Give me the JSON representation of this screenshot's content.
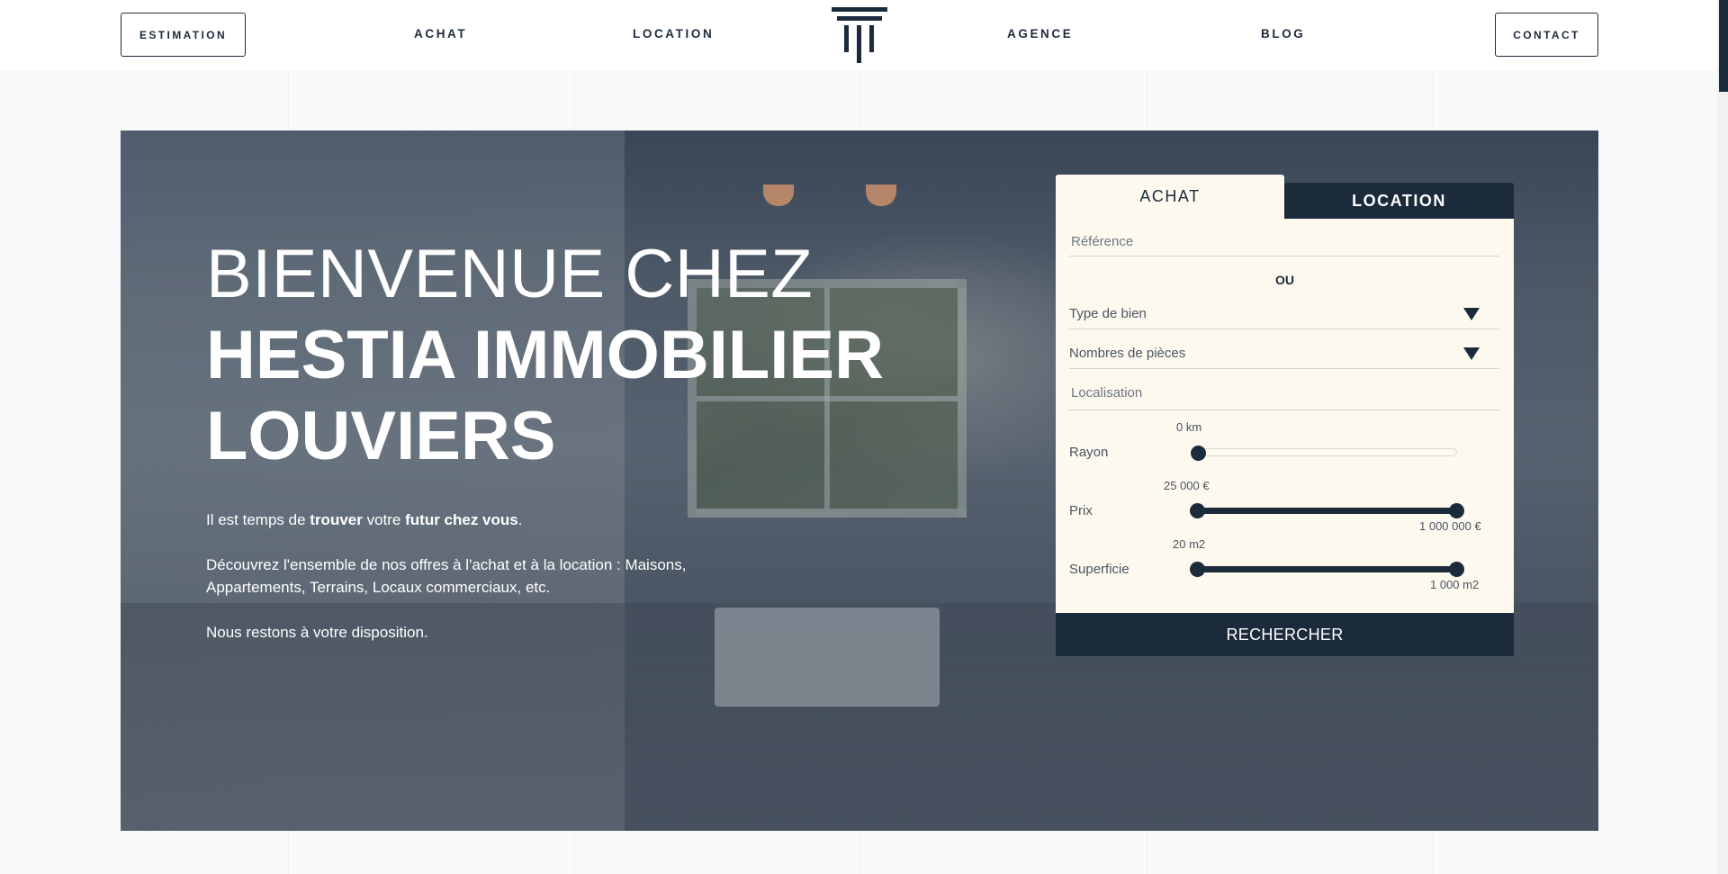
{
  "header": {
    "estimation_label": "ESTIMATION",
    "achat_label": "ACHAT",
    "location_label": "LOCATION",
    "agence_label": "AGENCE",
    "blog_label": "BLOG",
    "contact_label": "CONTACT",
    "logo_icon": "greek-column-icon"
  },
  "hero": {
    "title_line1": "BIENVENUE CHEZ",
    "title_line2": "HESTIA IMMOBILIER",
    "title_line3": "LOUVIERS",
    "intro": {
      "prefix": "Il est temps de ",
      "bold1": "trouver",
      "middle": " votre ",
      "bold2": "futur chez vous",
      "suffix": "."
    },
    "paragraph2": "Découvrez l'ensemble de nos offres à l'achat et à la location : Maisons, Appartements, Terrains, Locaux commerciaux, etc.",
    "paragraph3": "Nous restons à votre disposition."
  },
  "search": {
    "tab_achat": "ACHAT",
    "tab_location": "LOCATION",
    "active_tab": "ACHAT",
    "reference_placeholder": "Référence",
    "ou_label": "OU",
    "type_de_bien_label": "Type de bien",
    "nombres_pieces_label": "Nombres de pièces",
    "localisation_placeholder": "Localisation",
    "rayon": {
      "label": "Rayon",
      "value": "0 km",
      "fraction": 0
    },
    "prix": {
      "label": "Prix",
      "min_label": "25 000 €",
      "max_label": "1 000 000 €",
      "min_fraction": 0,
      "max_fraction": 1
    },
    "superficie": {
      "label": "Superficie",
      "min_label": "20 m2",
      "max_label": "1 000 m2",
      "min_fraction": 0,
      "max_fraction": 1
    },
    "button_label": "RECHERCHER"
  },
  "colors": {
    "navy": "#1c2b3c",
    "cream": "#fdf9ee",
    "background": "#f8f9f9"
  }
}
